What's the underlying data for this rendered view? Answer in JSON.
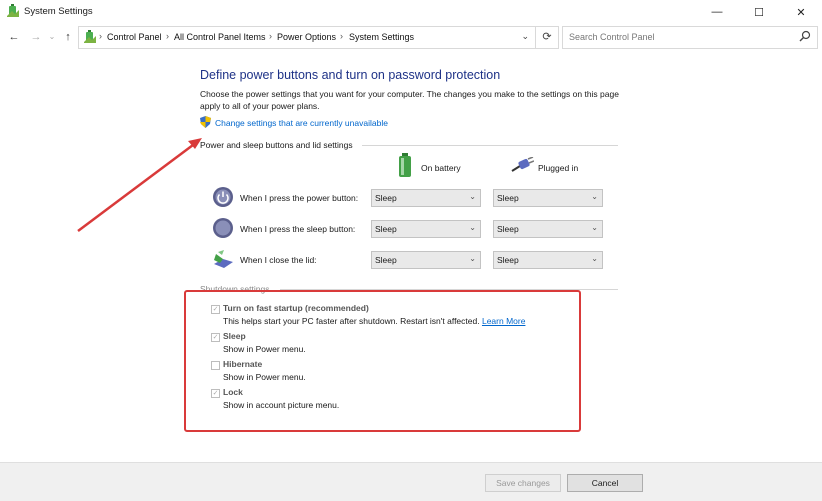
{
  "window": {
    "title": "System Settings",
    "controls": {
      "minimize": "—",
      "maximize": "☐",
      "close": "✕"
    }
  },
  "address_bar": {
    "back_icon": "arrow-left-icon",
    "forward_icon": "arrow-right-icon",
    "up_icon": "arrow-up-icon",
    "breadcrumbs": [
      "Control Panel",
      "All Control Panel Items",
      "Power Options",
      "System Settings"
    ],
    "search_placeholder": "Search Control Panel"
  },
  "page": {
    "heading": "Define power buttons and turn on password protection",
    "description": "Choose the power settings that you want for your computer. The changes you make to the settings on this page apply to all of your power plans.",
    "change_link": "Change settings that are currently unavailable"
  },
  "power_section": {
    "title": "Power and sleep buttons and lid settings",
    "col_battery": "On battery",
    "col_plugged": "Plugged in",
    "rows": [
      {
        "label": "When I press the power button:",
        "battery": "Sleep",
        "plugged": "Sleep",
        "icon": "power-button-icon"
      },
      {
        "label": "When I press the sleep button:",
        "battery": "Sleep",
        "plugged": "Sleep",
        "icon": "sleep-button-icon"
      },
      {
        "label": "When I close the lid:",
        "battery": "Sleep",
        "plugged": "Sleep",
        "icon": "laptop-lid-icon"
      }
    ]
  },
  "shutdown_section": {
    "title": "Shutdown settings",
    "items": [
      {
        "title": "Turn on fast startup (recommended)",
        "desc": "This helps start your PC faster after shutdown. Restart isn't affected.",
        "link": "Learn More",
        "checked": true
      },
      {
        "title": "Sleep",
        "desc": "Show in Power menu.",
        "checked": true
      },
      {
        "title": "Hibernate",
        "desc": "Show in Power menu.",
        "checked": false
      },
      {
        "title": "Lock",
        "desc": "Show in account picture menu.",
        "checked": true
      }
    ]
  },
  "footer": {
    "save_label": "Save changes",
    "cancel_label": "Cancel"
  },
  "colors": {
    "heading": "#1e3287",
    "link": "#0066cc",
    "annotation": "#d93a3a"
  }
}
